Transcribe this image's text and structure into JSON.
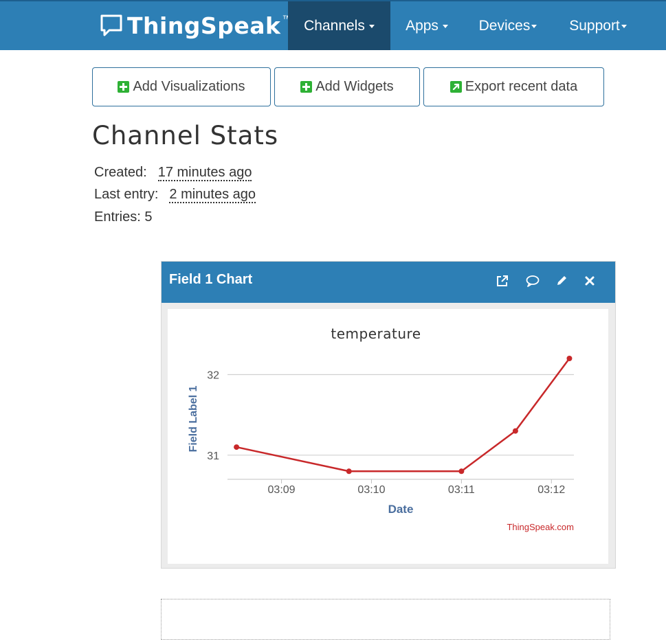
{
  "navbar": {
    "brand": "ThingSpeak",
    "trademark": "™",
    "items": [
      {
        "label": "Channels",
        "active": true
      },
      {
        "label": "Apps",
        "active": false
      },
      {
        "label": "Devices",
        "active": false
      },
      {
        "label": "Support",
        "active": false
      }
    ]
  },
  "actions": {
    "add_visualizations": "Add Visualizations",
    "add_widgets": "Add Widgets",
    "export_recent_data": "Export recent data"
  },
  "stats": {
    "title": "Channel Stats",
    "created_label": "Created:",
    "created_value": "17 minutes ago",
    "last_entry_label": "Last entry:",
    "last_entry_value": "2 minutes ago",
    "entries_label": "Entries: 5"
  },
  "panel": {
    "title": "Field 1 Chart",
    "icons": [
      "external-link-icon",
      "comment-icon",
      "pencil-icon",
      "close-icon"
    ]
  },
  "chart_data": {
    "type": "line",
    "title": "temperature",
    "xlabel": "Date",
    "ylabel": "Field Label 1",
    "credit": "ThingSpeak.com",
    "x": [
      "03:08:30",
      "03:09:45",
      "03:11:00",
      "03:11:36",
      "03:12:12"
    ],
    "values": [
      31.1,
      30.8,
      30.8,
      31.3,
      32.2
    ],
    "x_ticks": [
      "03:09",
      "03:10",
      "03:11",
      "03:12"
    ],
    "y_ticks": [
      "31",
      "32"
    ],
    "ylim": [
      30.7,
      32.2
    ],
    "series_color": "#c8282a",
    "grid": true,
    "legend": "none"
  },
  "colors": {
    "nav_bg": "#2d7fb5",
    "nav_active": "#1b4a6c",
    "accent_green": "#2eb135"
  }
}
